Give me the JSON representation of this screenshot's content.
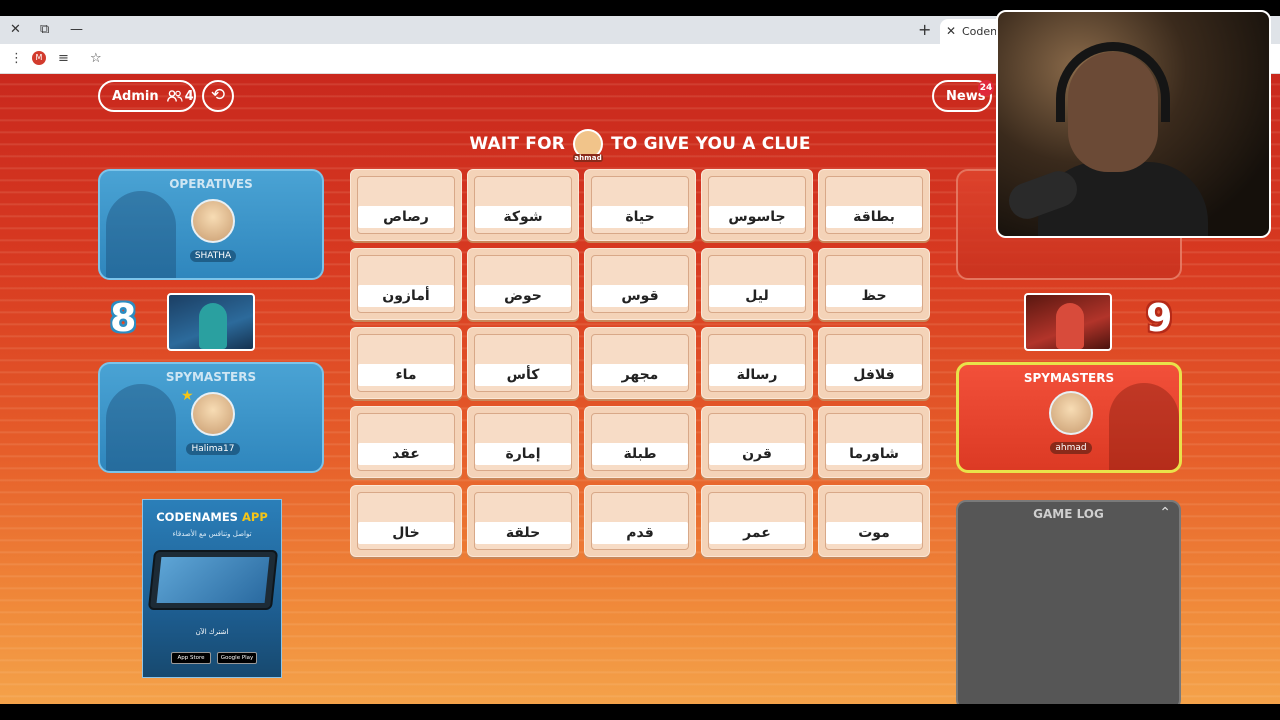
{
  "browser": {
    "tab_title": "Codenam",
    "close_glyph": "✕",
    "restore_glyph": "⧉",
    "minimize_glyph": "—",
    "new_tab_glyph": "+",
    "profile_initial": "M"
  },
  "topbar": {
    "admin_label": "Admin",
    "players_count": "4",
    "news_label": "News",
    "news_badge": "24"
  },
  "headline": {
    "prefix": "WAIT FOR",
    "player": "ahmad",
    "suffix": "TO GIVE YOU A CLUE"
  },
  "blue_team": {
    "operatives_title": "OPERATIVES",
    "operative_name": "SHATHA",
    "score": "8",
    "spymasters_title": "SPYMASTERS",
    "spymaster_name": "Halima17",
    "color": "#2f86bd"
  },
  "red_team": {
    "score": "9",
    "spymasters_title": "SPYMASTERS",
    "spymaster_name": "ahmad",
    "color": "#dc3a24"
  },
  "board": {
    "rows": [
      [
        "رصاص",
        "شوكة",
        "حياة",
        "جاسوس",
        "بطاقة"
      ],
      [
        "أمازون",
        "حوض",
        "قوس",
        "ليل",
        "حظ"
      ],
      [
        "ماء",
        "كأس",
        "مجهر",
        "رسالة",
        "فلافل"
      ],
      [
        "عقد",
        "إمارة",
        "طبلة",
        "قرن",
        "شاورما"
      ],
      [
        "خال",
        "حلقة",
        "قدم",
        "عمر",
        "موت"
      ]
    ]
  },
  "promo": {
    "title_a": "CODENAMES",
    "title_b": "APP",
    "subtitle": "تواصل وتنافس مع الأصدقاء",
    "cta": "اشترك الآن",
    "app_store": "App Store",
    "google_play": "Google Play"
  },
  "game_log": {
    "title": "GAME LOG"
  }
}
